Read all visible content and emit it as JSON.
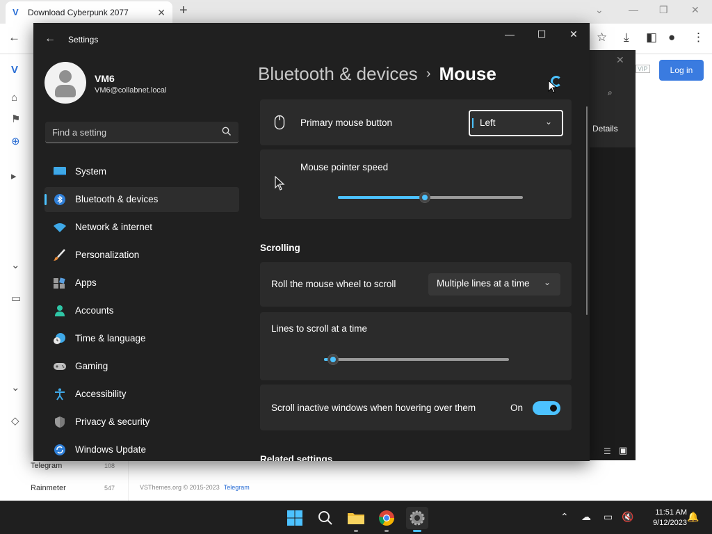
{
  "browser": {
    "tab_title": "Download Cyberpunk 2077",
    "new_tab": "+",
    "login_label": "Log in",
    "vip_label": "VIP",
    "details_label": "Details",
    "footer_text": "VSThemes.org © 2015-2023",
    "footer_link": "Telegram",
    "left_items": [
      {
        "label": "Telegram",
        "count": "108"
      },
      {
        "label": "Rainmeter",
        "count": "547"
      }
    ]
  },
  "settings": {
    "app_title": "Settings",
    "user": {
      "name": "VM6",
      "email": "VM6@collabnet.local"
    },
    "search_placeholder": "Find a setting",
    "nav": [
      {
        "label": "System",
        "icon": "system-icon"
      },
      {
        "label": "Bluetooth & devices",
        "icon": "bluetooth-icon",
        "active": true
      },
      {
        "label": "Network & internet",
        "icon": "wifi-icon"
      },
      {
        "label": "Personalization",
        "icon": "brush-icon"
      },
      {
        "label": "Apps",
        "icon": "apps-icon"
      },
      {
        "label": "Accounts",
        "icon": "accounts-icon"
      },
      {
        "label": "Time & language",
        "icon": "globe-clock-icon"
      },
      {
        "label": "Gaming",
        "icon": "gamepad-icon"
      },
      {
        "label": "Accessibility",
        "icon": "accessibility-icon"
      },
      {
        "label": "Privacy & security",
        "icon": "shield-icon"
      },
      {
        "label": "Windows Update",
        "icon": "update-icon"
      }
    ],
    "breadcrumb": {
      "parent": "Bluetooth & devices",
      "separator": "›",
      "current": "Mouse"
    },
    "primary_button": {
      "label": "Primary mouse button",
      "value": "Left"
    },
    "pointer_speed": {
      "label": "Mouse pointer speed",
      "value_fraction": 0.47
    },
    "scrolling": {
      "title": "Scrolling",
      "roll_label": "Roll the mouse wheel to scroll",
      "roll_value": "Multiple lines at a time",
      "lines_label": "Lines to scroll at a time",
      "lines_fraction": 0.05,
      "inactive_label": "Scroll inactive windows when hovering over them",
      "inactive_state": "On"
    },
    "related_title": "Related settings",
    "accent_color": "#4cc2ff"
  },
  "taskbar": {
    "time": "11:51 AM",
    "date": "9/12/2023"
  }
}
